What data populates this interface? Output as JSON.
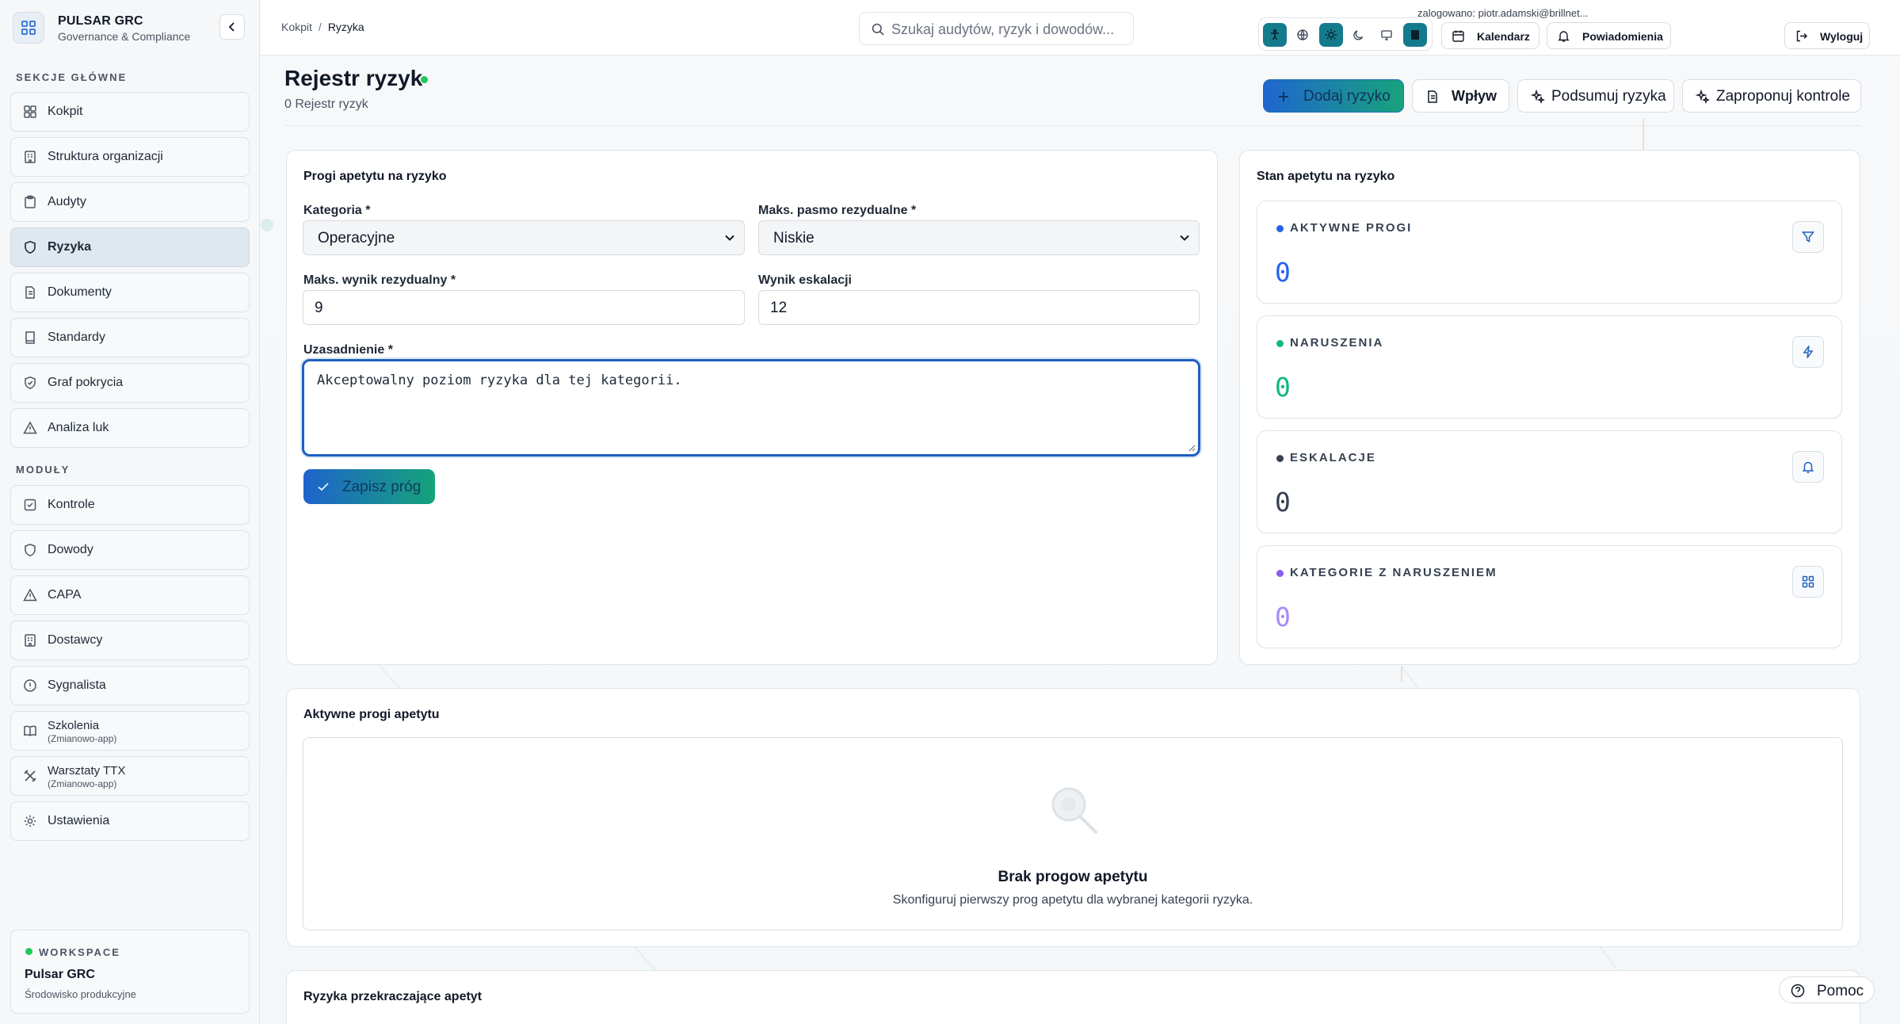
{
  "brand": {
    "title": "PULSAR GRC",
    "subtitle": "Governance & Compliance"
  },
  "sidebar": {
    "section_main": "SEKCJE GŁÓWNE",
    "section_modules": "MODUŁY",
    "items": [
      {
        "label": "Kokpit",
        "icon": "dashboard-icon"
      },
      {
        "label": "Struktura organizacji",
        "icon": "building-icon"
      },
      {
        "label": "Audyty",
        "icon": "clipboard-icon"
      },
      {
        "label": "Ryzyka",
        "icon": "shield-icon",
        "active": true
      },
      {
        "label": "Dokumenty",
        "icon": "document-icon"
      },
      {
        "label": "Standardy",
        "icon": "book-icon"
      },
      {
        "label": "Graf pokrycia",
        "icon": "shield-check-icon"
      },
      {
        "label": "Analiza luk",
        "icon": "warning-triangle-icon"
      }
    ],
    "modules": [
      {
        "label": "Kontrole",
        "icon": "checkbox-icon"
      },
      {
        "label": "Dowody",
        "icon": "shield-icon"
      },
      {
        "label": "CAPA",
        "icon": "warning-triangle-icon"
      },
      {
        "label": "Dostawcy",
        "icon": "building-icon"
      },
      {
        "label": "Sygnalista",
        "icon": "info-circle-icon"
      },
      {
        "label": "Szkolenia",
        "sub": "(Zmianowo-app)",
        "icon": "open-book-icon"
      },
      {
        "label": "Warsztaty TTX",
        "sub": "(Zmianowo-app)",
        "icon": "tools-icon"
      },
      {
        "label": "Ustawienia",
        "icon": "gear-icon"
      }
    ],
    "workspace": {
      "label": "WORKSPACE",
      "name": "Pulsar GRC",
      "env": "Środowisko produkcyjne"
    }
  },
  "topbar": {
    "breadcrumb": [
      "Kokpit",
      "Ryzyka"
    ],
    "search_placeholder": "Szukaj audytów, ryzyk i dowodów...",
    "calendar_label": "Kalendarz",
    "notifications_label": "Powiadomienia",
    "logout_label": "Wyloguj",
    "user_line": "zalogowano: piotr.adamski@brillnet..."
  },
  "page": {
    "title": "Rejestr ryzyk",
    "subtitle": "0 Rejestr ryzyk",
    "actions": {
      "add": "Dodaj ryzyko",
      "impact": "Wpływ",
      "summarize": "Podsumuj ryzyka",
      "propose": "Zaproponuj kontrole"
    }
  },
  "form": {
    "title": "Progi apetytu na ryzyko",
    "category_label": "Kategoria *",
    "category_value": "Operacyjne",
    "band_label": "Maks. pasmo rezydualne *",
    "band_value": "Niskie",
    "max_score_label": "Maks. wynik rezydualny *",
    "max_score_value": "9",
    "escalation_label": "Wynik eskalacji",
    "escalation_value": "12",
    "justification_label": "Uzasadnienie *",
    "justification_value": "Akceptowalny poziom ryzyka dla tej kategorii.",
    "save_label": "Zapisz próg"
  },
  "status": {
    "title": "Stan apetytu na ryzyko",
    "cards": [
      {
        "label": "AKTYWNE PROGI",
        "value": "0",
        "color": "#2563eb",
        "dot": "#2563eb",
        "icon": "filter-icon"
      },
      {
        "label": "NARUSZENIA",
        "value": "0",
        "color": "#10b981",
        "dot": "#10b981",
        "icon": "lightning-icon"
      },
      {
        "label": "ESKALACJE",
        "value": "0",
        "color": "#374151",
        "dot": "#374151",
        "icon": "bell-icon"
      },
      {
        "label": "KATEGORIE Z NARUSZENIEM",
        "value": "0",
        "color": "#a78bfa",
        "dot": "#8b5cf6",
        "icon": "grid-icon"
      }
    ]
  },
  "active_thresholds": {
    "title": "Aktywne progi apetytu",
    "empty_title": "Brak progow apetytu",
    "empty_desc": "Skonfiguruj pierwszy prog apetytu dla wybranej kategorii ryzyka."
  },
  "exceeding": {
    "title": "Ryzyka przekraczające apetyt"
  },
  "help_label": "Pomoc"
}
